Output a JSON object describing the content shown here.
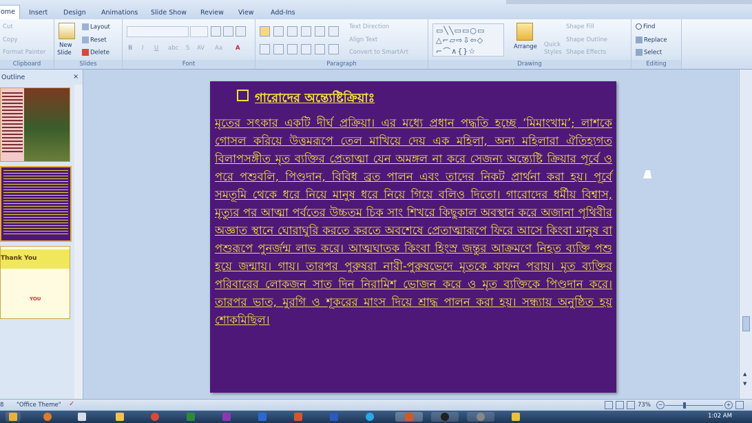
{
  "tabs": [
    {
      "label": "ome",
      "active": true
    },
    {
      "label": "Insert"
    },
    {
      "label": "Design"
    },
    {
      "label": "Animations"
    },
    {
      "label": "Slide Show"
    },
    {
      "label": "Review"
    },
    {
      "label": "View"
    },
    {
      "label": "Add-Ins"
    }
  ],
  "ribbon": {
    "clipboard": {
      "cut": "Cut",
      "copy": "Copy",
      "format_painter": "Format Painter",
      "label": "Clipboard"
    },
    "slides": {
      "new_slide_1": "New",
      "new_slide_2": "Slide",
      "layout": "Layout",
      "reset": "Reset",
      "delete": "Delete",
      "label": "Slides"
    },
    "font": {
      "label": "Font"
    },
    "paragraph": {
      "text_direction": "Text Direction",
      "align_text": "Align Text",
      "convert_smartart": "Convert to SmartArt",
      "label": "Paragraph"
    },
    "drawing": {
      "arrange": "Arrange",
      "quick_styles_1": "Quick",
      "quick_styles_2": "Styles",
      "shape_fill": "Shape Fill",
      "shape_outline": "Shape Outline",
      "shape_effects": "Shape Effects",
      "label": "Drawing"
    },
    "editing": {
      "find": "Find",
      "replace": "Replace",
      "select": "Select",
      "label": "Editing"
    }
  },
  "left_panel": {
    "outline_tab": "Outline",
    "thumb3_title": "Thank You",
    "thumb3_sub": "YOU"
  },
  "slide": {
    "title": "গারোদের অন্ত্যেষ্টিক্রিয়াঃ",
    "body": "মৃতের সৎকার একটি দীর্ঘ প্রক্রিয়া। এর মধ্যে প্রধান পদ্ধতি হচ্ছে ‘মিমাংখাম’; লাশকে গোসল করিয়ে উত্তমরূপে তেল মাখিয়ে দেয় এক মহিলা, অন্য মহিলারা ঐতিহ্যগত বিলাপসঙ্গীত মৃত ব্যক্তির প্রেতাত্মা যেন অমঙ্গল না করে সেজন্য অন্ত্যেষ্টি ক্রিয়ার পূর্বে ও পরে পশুবলি, পিণ্ডদান, বিবিধ ব্রত পালন এবং তাদের নিকট প্রার্থনা করা হয়। পূর্বে সমতূমি থেকে ধরে নিয়ে মানুষ ধরে নিয়ে গিয়ে বলিও দিতো। গারোদের ধর্মীয় বিশ্বাস, মৃত্যুর পর আত্মা পর্বতের উচ্চতম চিক সাং শিখরে কিছুকাল অবস্থান করে অজানা পৃথিবীর অজ্ঞাত স্থানে ঘোরাঘুরি করতে করতে অবশেষে প্রেতাত্মারূপে ফিরে আসে কিংবা মানুষ বা পশুরূপে পুনর্জন্ম লাভ করে। আত্মঘাতক কিংবা হিংস্র জন্তুর আক্রমণে নিহত ব্যক্তি পশু হয়ে জন্মায়। গায়। তারপর পুরুষরা নারী-পুরুষভেদে মৃতকে কাফন পরায়। মৃত ব্যক্তির পরিবারের লোকজন সাত দিন নিরামিশ ভোজন করে ও মৃত ব্যক্তিকে পিণ্ডদান করে। তারপর ভাত, মুরগি ও শূকরের মাংস দিয়ে শ্রাদ্ধ পালন করা হয়। সন্ধ্যায় অনুষ্ঠিত হয় শোকমিছিল।"
  },
  "status": {
    "slide_num": "8",
    "theme": "\"Office Theme\"",
    "zoom": "73%"
  },
  "taskbar": {
    "clock": "1:02 AM"
  }
}
